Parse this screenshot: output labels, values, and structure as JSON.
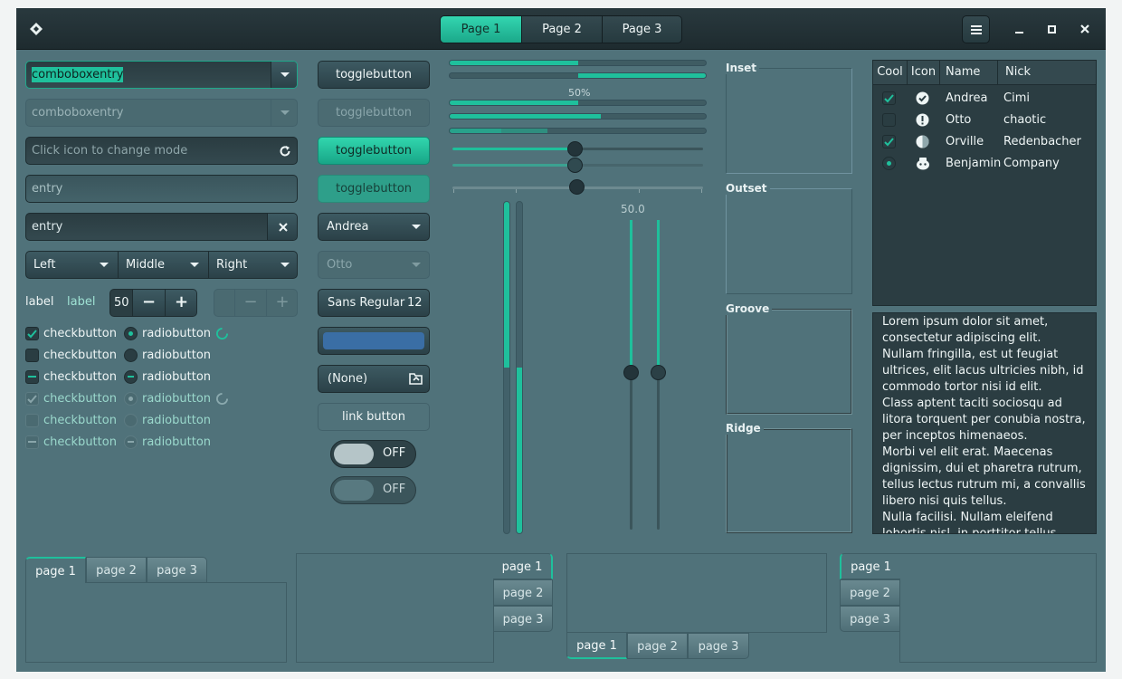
{
  "headerbar": {
    "tabs": [
      "Page 1",
      "Page 2",
      "Page 3"
    ]
  },
  "col1": {
    "combo1": "comboboxentry",
    "combo2": "comboboxentry",
    "entry_placeholder": "Click icon to change mode",
    "entry2": "entry",
    "entry3": "entry",
    "combos": [
      "Left",
      "Middle",
      "Right"
    ],
    "label1": "label",
    "label2": "label",
    "spin1": "50",
    "checks": [
      "checkbutton",
      "checkbutton",
      "checkbutton",
      "checkbutton",
      "checkbutton",
      "checkbutton"
    ],
    "radios": [
      "radiobutton",
      "radiobutton",
      "radiobutton",
      "radiobutton",
      "radiobutton",
      "radiobutton"
    ]
  },
  "col2": {
    "toggles": [
      "togglebutton",
      "togglebutton",
      "togglebutton",
      "togglebutton"
    ],
    "combo_andrea": "Andrea",
    "combo_otto": "Otto",
    "font": "Sans Regular",
    "font_size": "12",
    "file": "(None)",
    "link": "link button",
    "switch1": "OFF",
    "switch2": "OFF"
  },
  "col3": {
    "progress_text": "50%",
    "scale_value": "50.0"
  },
  "frames": [
    "Inset",
    "Outset",
    "Groove",
    "Ridge"
  ],
  "tree": {
    "headers": [
      "Cool",
      "Icon",
      "Name",
      "Nick"
    ],
    "rows": [
      {
        "name": "Andrea",
        "nick": "Cimi",
        "icon": "checkmark-circle-icon"
      },
      {
        "name": "Otto",
        "nick": "chaotic",
        "icon": "exclamation-circle-icon"
      },
      {
        "name": "Orville",
        "nick": "Redenbacher",
        "icon": "moon-icon"
      },
      {
        "name": "Benjamin",
        "nick": "Company",
        "icon": "face-icon"
      }
    ]
  },
  "textview": "Lorem ipsum dolor sit amet, consectetur adipiscing elit.\nNullam fringilla, est ut feugiat ultrices, elit lacus ultricies nibh, id commodo tortor nisi id elit.\nClass aptent taciti sociosqu ad litora torquent per conubia nostra, per inceptos himenaeos.\nMorbi vel elit erat. Maecenas dignissim, dui et pharetra rutrum, tellus lectus rutrum mi, a convallis libero nisi quis tellus.\nNulla facilisi. Nullam eleifend lobortis nisl, in porttitor tellus malesuada vitae.",
  "notebook_tabs": [
    "page 1",
    "page 2",
    "page 3"
  ],
  "colors": {
    "accent": "#1fc09c",
    "window": "#50727a",
    "header": "#243337",
    "color_button": "#3a6ea5"
  }
}
